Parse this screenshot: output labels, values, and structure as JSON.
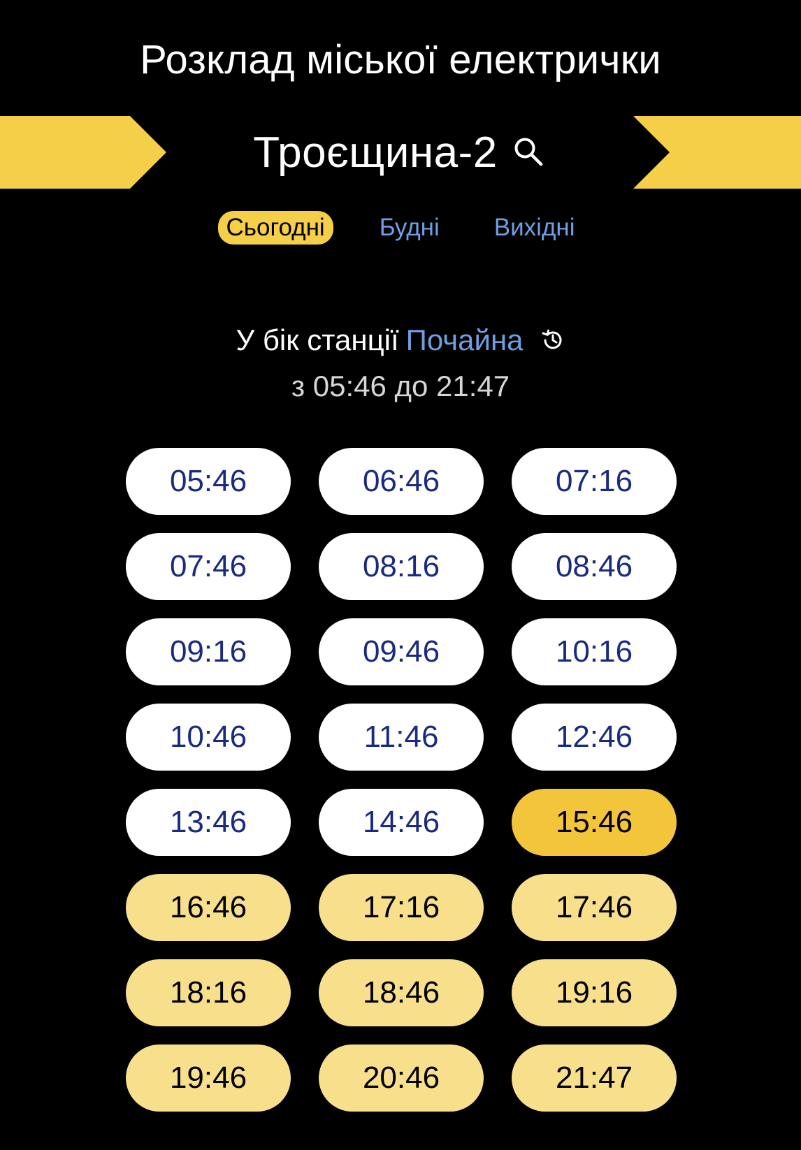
{
  "header": {
    "title": "Розклад міської електрички"
  },
  "station": {
    "name": "Троєщина-2"
  },
  "tabs": [
    {
      "label": "Сьогодні",
      "active": true
    },
    {
      "label": "Будні",
      "active": false
    },
    {
      "label": "Вихідні",
      "active": false
    }
  ],
  "direction": {
    "prefix": "У бік станції",
    "destination": "Почайна",
    "range": "з 05:46 до 21:47"
  },
  "times": [
    {
      "time": "05:46",
      "state": "past"
    },
    {
      "time": "06:46",
      "state": "past"
    },
    {
      "time": "07:16",
      "state": "past"
    },
    {
      "time": "07:46",
      "state": "past"
    },
    {
      "time": "08:16",
      "state": "past"
    },
    {
      "time": "08:46",
      "state": "past"
    },
    {
      "time": "09:16",
      "state": "past"
    },
    {
      "time": "09:46",
      "state": "past"
    },
    {
      "time": "10:16",
      "state": "past"
    },
    {
      "time": "10:46",
      "state": "past"
    },
    {
      "time": "11:46",
      "state": "past"
    },
    {
      "time": "12:46",
      "state": "past"
    },
    {
      "time": "13:46",
      "state": "past"
    },
    {
      "time": "14:46",
      "state": "past"
    },
    {
      "time": "15:46",
      "state": "current"
    },
    {
      "time": "16:46",
      "state": "upcoming"
    },
    {
      "time": "17:16",
      "state": "upcoming"
    },
    {
      "time": "17:46",
      "state": "upcoming"
    },
    {
      "time": "18:16",
      "state": "upcoming"
    },
    {
      "time": "18:46",
      "state": "upcoming"
    },
    {
      "time": "19:16",
      "state": "upcoming"
    },
    {
      "time": "19:46",
      "state": "upcoming"
    },
    {
      "time": "20:46",
      "state": "upcoming"
    },
    {
      "time": "21:47",
      "state": "upcoming"
    }
  ],
  "colors": {
    "background": "#000000",
    "accent_yellow": "#f4cf47",
    "link_blue": "#6f9fe2",
    "current_slot": "#f3c53a",
    "upcoming_slot": "#f7df8c",
    "past_slot": "#ffffff",
    "past_text": "#1a2a80"
  },
  "icons": {
    "search": "search-icon",
    "history": "history-icon",
    "prev": "prev-station-arrow",
    "next": "next-station-arrow"
  }
}
